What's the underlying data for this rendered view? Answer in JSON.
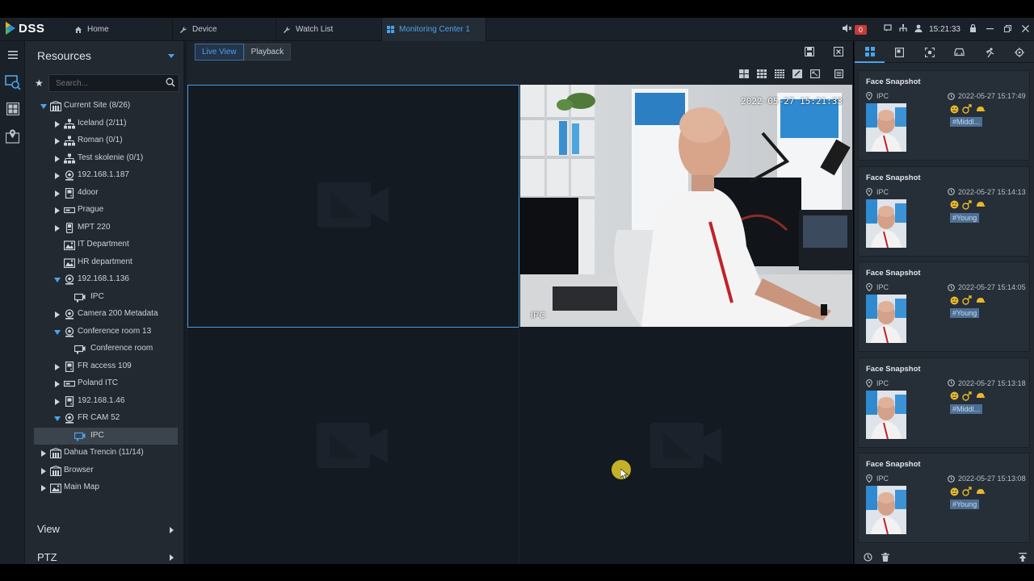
{
  "app": {
    "logo_text": "DSS"
  },
  "tabs": [
    {
      "label": "Home",
      "icon": "home-icon"
    },
    {
      "label": "Device",
      "icon": "wrench-icon"
    },
    {
      "label": "Watch List",
      "icon": "wrench-icon"
    },
    {
      "label": "Monitoring Center 1",
      "icon": "grid-icon"
    }
  ],
  "header": {
    "alarm_count": "0",
    "clock": "15:21:33"
  },
  "resources": {
    "title": "Resources",
    "search_placeholder": "Search...",
    "tree": [
      {
        "label": "Current Site (8/26)",
        "level": 0,
        "expand": "down",
        "icon": "site-icon"
      },
      {
        "label": "Iceland (2/11)",
        "level": 1,
        "expand": "right",
        "icon": "org-icon"
      },
      {
        "label": "Roman (0/1)",
        "level": 1,
        "expand": "right",
        "icon": "org-icon"
      },
      {
        "label": "Test skolenie (0/1)",
        "level": 1,
        "expand": "right",
        "icon": "org-icon"
      },
      {
        "label": "192.168.1.187",
        "level": 1,
        "expand": "right",
        "icon": "nvr-icon"
      },
      {
        "label": "4door",
        "level": 1,
        "expand": "right",
        "icon": "access-icon"
      },
      {
        "label": "Prague",
        "level": 1,
        "expand": "right",
        "icon": "dvr-icon"
      },
      {
        "label": "MPT 220",
        "level": 1,
        "expand": "right",
        "icon": "phone-icon"
      },
      {
        "label": "IT Department",
        "level": 1,
        "expand": "none",
        "icon": "map-icon"
      },
      {
        "label": "HR department",
        "level": 1,
        "expand": "none",
        "icon": "map-icon"
      },
      {
        "label": "192.168.1.136",
        "level": 1,
        "expand": "down",
        "icon": "nvr-icon"
      },
      {
        "label": "IPC",
        "level": 2,
        "expand": "none",
        "icon": "camera-icon"
      },
      {
        "label": "Camera 200 Metadata",
        "level": 1,
        "expand": "right",
        "icon": "nvr-icon"
      },
      {
        "label": "Conference room 13",
        "level": 1,
        "expand": "down",
        "icon": "nvr-icon"
      },
      {
        "label": "Conference room",
        "level": 2,
        "expand": "none",
        "icon": "camera-icon"
      },
      {
        "label": "FR access 109",
        "level": 1,
        "expand": "right",
        "icon": "access-icon"
      },
      {
        "label": "Poland ITC",
        "level": 1,
        "expand": "right",
        "icon": "dvr-icon"
      },
      {
        "label": "192.168.1.46",
        "level": 1,
        "expand": "right",
        "icon": "access-icon"
      },
      {
        "label": "FR CAM 52",
        "level": 1,
        "expand": "down",
        "icon": "nvr-icon"
      },
      {
        "label": "IPC",
        "level": 2,
        "expand": "none",
        "icon": "camera-icon",
        "selected": true
      },
      {
        "label": "Dahua  Trencin (11/14)",
        "level": 0,
        "expand": "right",
        "icon": "site-icon"
      },
      {
        "label": "Browser",
        "level": 0,
        "expand": "right",
        "icon": "site-icon"
      },
      {
        "label": "Main Map",
        "level": 0,
        "expand": "right",
        "icon": "map-icon"
      }
    ],
    "sections": [
      "View",
      "PTZ"
    ]
  },
  "monitor": {
    "tabs": [
      "Live View",
      "Playback"
    ],
    "active_tab": "Live View",
    "video": {
      "osd_time": "2022-05-27 15:21:33",
      "osd_name": "IPC"
    }
  },
  "snapshots": [
    {
      "title": "Face Snapshot",
      "device": "IPC",
      "time": "2022-05-27 15:17:49",
      "tag": "#Middl..."
    },
    {
      "title": "Face Snapshot",
      "device": "IPC",
      "time": "2022-05-27 15:14:13",
      "tag": "#Young"
    },
    {
      "title": "Face Snapshot",
      "device": "IPC",
      "time": "2022-05-27 15:14:05",
      "tag": "#Young"
    },
    {
      "title": "Face Snapshot",
      "device": "IPC",
      "time": "2022-05-27 15:13:18",
      "tag": "#Middl..."
    },
    {
      "title": "Face Snapshot",
      "device": "IPC",
      "time": "2022-05-27 15:13:08",
      "tag": "#Young"
    }
  ],
  "colors": {
    "accent": "#4ba3ea",
    "alarm": "#c83a3a",
    "attribute": "#e8b72a",
    "tag_bg": "#4d6f94"
  }
}
